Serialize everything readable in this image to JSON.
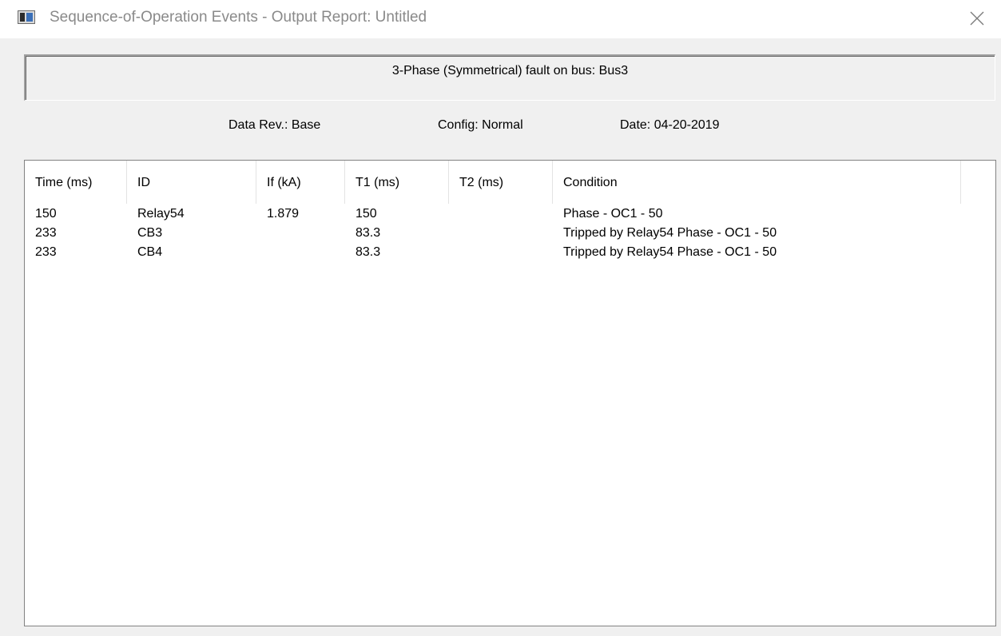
{
  "window": {
    "title": "Sequence-of-Operation Events - Output Report: Untitled",
    "close_icon": "close-icon"
  },
  "report": {
    "fault_description": "3-Phase (Symmetrical) fault on bus: Bus3",
    "data_rev": "Data Rev.:  Base",
    "config": "Config:  Normal",
    "date": "Date:  04-20-2019"
  },
  "table": {
    "columns": [
      "Time (ms)",
      "ID",
      "If (kA)",
      "T1 (ms)",
      "T2 (ms)",
      "Condition"
    ],
    "rows": [
      [
        "150",
        "Relay54",
        "1.879",
        "150",
        "",
        "Phase - OC1 - 50"
      ],
      [
        "233",
        "CB3",
        "",
        "83.3",
        "",
        "Tripped by Relay54 Phase - OC1 - 50"
      ],
      [
        "233",
        "CB4",
        "",
        "83.3",
        "",
        "Tripped by Relay54 Phase - OC1 - 50"
      ]
    ]
  }
}
